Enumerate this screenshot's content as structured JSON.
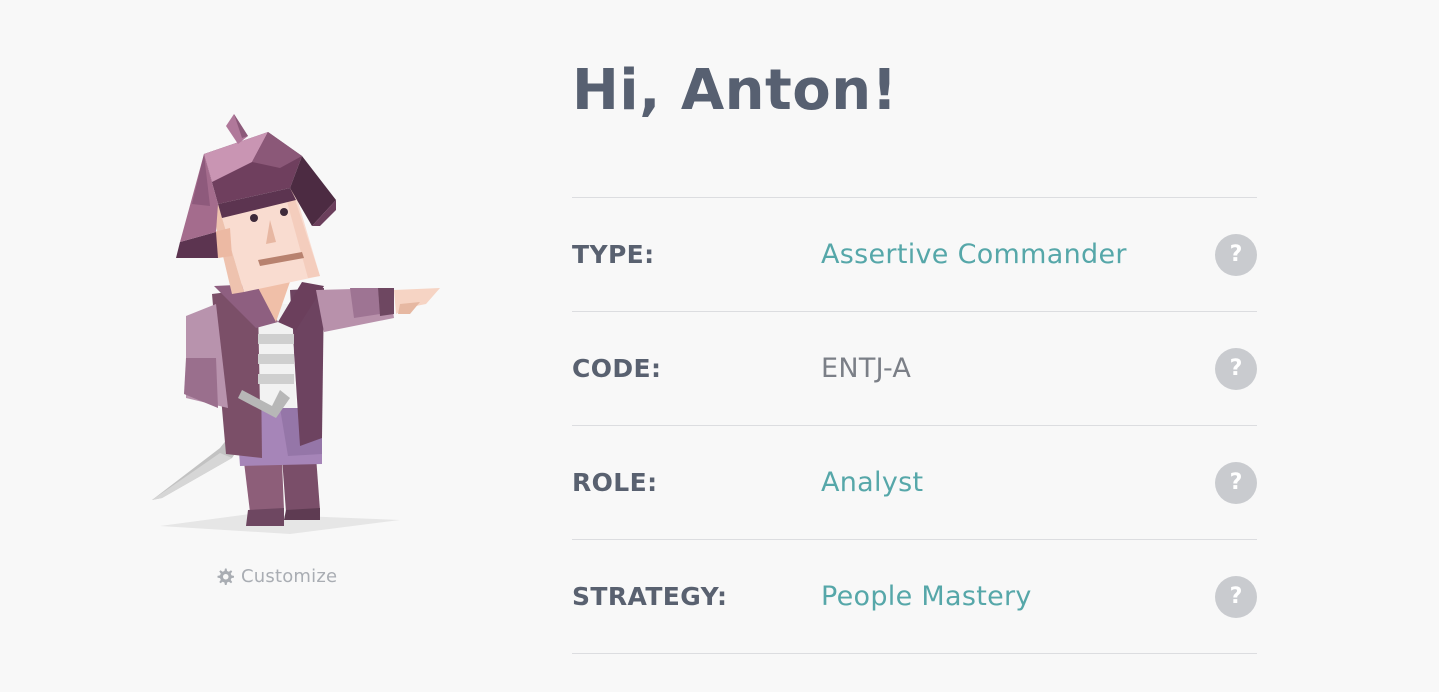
{
  "profile": {
    "greeting": "Hi, Anton!",
    "customize_label": "Customize"
  },
  "rows": [
    {
      "label": "TYPE:",
      "value": "Assertive Commander",
      "help": "?"
    },
    {
      "label": "CODE:",
      "value": "ENTJ-A",
      "help": "?"
    },
    {
      "label": "ROLE:",
      "value": "Analyst",
      "help": "?"
    },
    {
      "label": "STRATEGY:",
      "value": "People Mastery",
      "help": "?"
    }
  ],
  "icons": {
    "avatar": "commander-avatar-illustration",
    "customize": "gear-icon",
    "help": "question-mark-icon"
  },
  "colors": {
    "background": "#f8f8f8",
    "heading": "#576071",
    "link_value": "#56a7a9",
    "plain_value": "#7b7f87",
    "help_button": "#c9cbcf",
    "divider": "#dcdde0"
  }
}
